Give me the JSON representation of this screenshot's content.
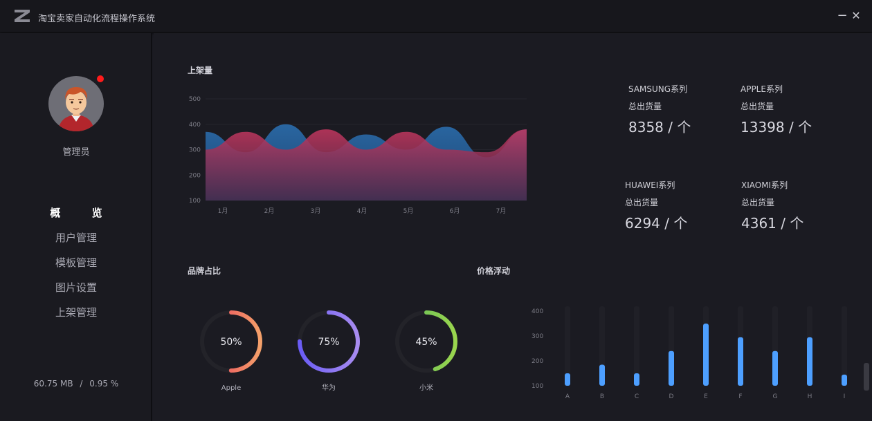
{
  "app": {
    "title": "淘宝卖家自动化流程操作系统",
    "minimize_label": "−",
    "close_label": "✕"
  },
  "sidebar": {
    "user_name": "管理员",
    "nav": [
      {
        "label": "概 览",
        "active": true
      },
      {
        "label": "用户管理"
      },
      {
        "label": "模板管理"
      },
      {
        "label": "图片设置"
      },
      {
        "label": "上架管理"
      }
    ],
    "memory": "60.75 MB",
    "sep": "/",
    "cpu": "0.95 %"
  },
  "listing": {
    "title": "上架量"
  },
  "stats": [
    {
      "name": "SAMSUNG系列",
      "sub": "总出货量",
      "value": "8358 / 个"
    },
    {
      "name": "APPLE系列",
      "sub": "总出货量",
      "value": "13398 / 个"
    },
    {
      "name": "HUAWEI系列",
      "sub": "总出货量",
      "value": "6294 / 个"
    },
    {
      "name": "XIAOMI系列",
      "sub": "总出货量",
      "value": "4361 / 个"
    }
  ],
  "brand": {
    "title": "品牌占比"
  },
  "price": {
    "title": "价格浮动"
  },
  "colors": {
    "red_area": "#c1365e",
    "blue_area": "#2a6aa8",
    "bar": "#4d9fff",
    "ring_bg": "#232329"
  },
  "chart_data": [
    {
      "type": "area",
      "title": "上架量",
      "categories": [
        "1月",
        "2月",
        "3月",
        "4月",
        "5月",
        "6月",
        "7月"
      ],
      "ylim": [
        100,
        500
      ],
      "yticks": [
        "100",
        "200",
        "300",
        "400",
        "500"
      ],
      "series": [
        {
          "values": [
            370,
            290,
            400,
            290,
            360,
            300,
            390,
            270,
            380
          ]
        },
        {
          "values": [
            300,
            370,
            300,
            380,
            300,
            370,
            300,
            290,
            380
          ]
        }
      ]
    },
    {
      "type": "pie",
      "title": "品牌占比",
      "items": [
        {
          "label": "Apple",
          "value": 50,
          "text": "50%",
          "colors": [
            "#e83c5a",
            "#f4a06a"
          ]
        },
        {
          "label": "华为",
          "value": 75,
          "text": "75%",
          "colors": [
            "#6a5cf5",
            "#a88cf0"
          ]
        },
        {
          "label": "小米",
          "value": 45,
          "text": "45%",
          "colors": [
            "#5cb85c",
            "#9ad64e"
          ]
        }
      ]
    },
    {
      "type": "bar",
      "title": "价格浮动",
      "categories": [
        "A",
        "B",
        "C",
        "D",
        "E",
        "F",
        "G",
        "H",
        "I"
      ],
      "values": [
        150,
        185,
        150,
        240,
        350,
        295,
        240,
        295,
        145
      ],
      "ylim": [
        100,
        420
      ],
      "yticks": [
        "100",
        "200",
        "300",
        "400"
      ]
    }
  ]
}
